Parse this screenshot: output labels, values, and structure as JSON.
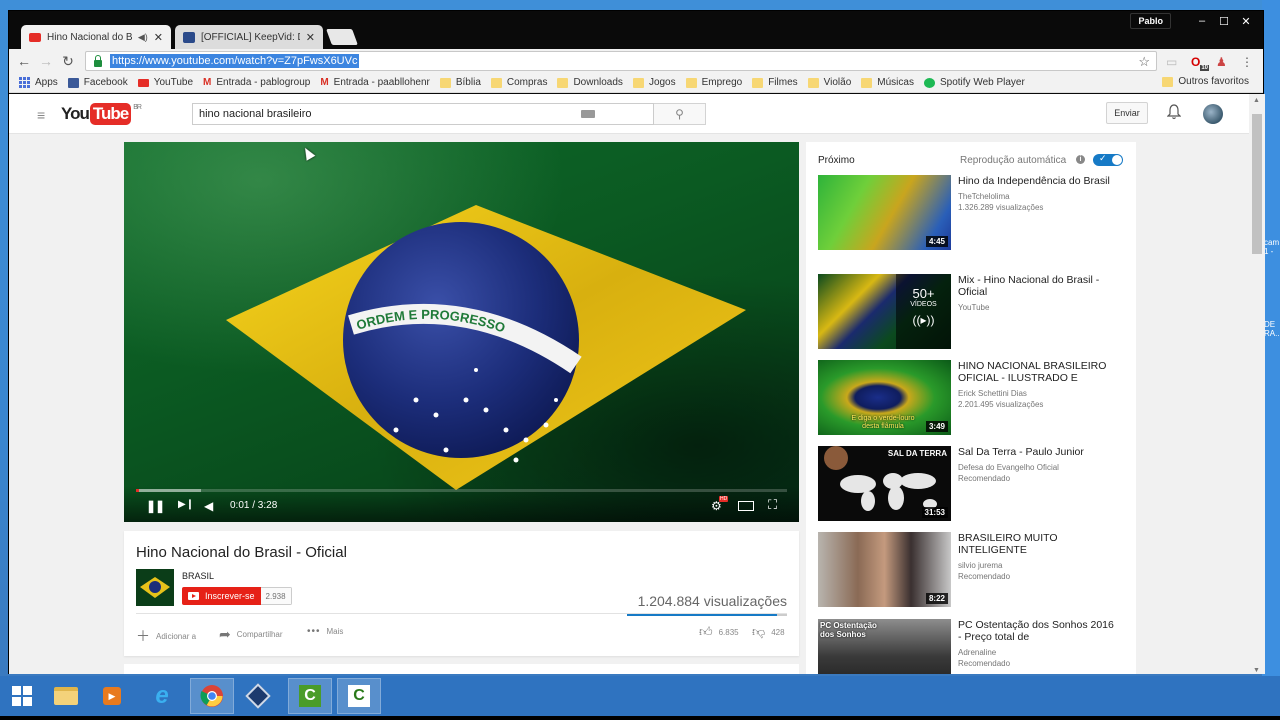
{
  "browser": {
    "tabs": [
      {
        "label": "Hino Nacional do Bra",
        "favicon": "youtube-icon",
        "active": true,
        "audio": true
      },
      {
        "label": "[OFFICIAL] KeepVid: Dow",
        "favicon": "keepvid-icon",
        "active": false
      }
    ],
    "profile_name": "Pablo",
    "window_controls": {
      "minimize": "–",
      "maximize": "☐",
      "close": "✕"
    },
    "url": "https://www.youtube.com/watch?v=Z7pFwsX6UVc",
    "extension_badge": "10",
    "bookmarks": [
      {
        "label": "Apps",
        "icon": "apps-grid-icon"
      },
      {
        "label": "Facebook",
        "icon": "facebook-icon"
      },
      {
        "label": "YouTube",
        "icon": "youtube-icon"
      },
      {
        "label": "Entrada - pablogroup",
        "icon": "gmail-icon"
      },
      {
        "label": "Entrada - paabllohenr",
        "icon": "gmail-icon"
      },
      {
        "label": "Bíblia",
        "icon": "folder-icon"
      },
      {
        "label": "Compras",
        "icon": "folder-icon"
      },
      {
        "label": "Downloads",
        "icon": "folder-icon"
      },
      {
        "label": "Jogos",
        "icon": "folder-icon"
      },
      {
        "label": "Emprego",
        "icon": "folder-icon"
      },
      {
        "label": "Filmes",
        "icon": "folder-icon"
      },
      {
        "label": "Violão",
        "icon": "folder-icon"
      },
      {
        "label": "Músicas",
        "icon": "folder-icon"
      },
      {
        "label": "Spotify Web Player",
        "icon": "spotify-icon"
      }
    ],
    "other_bookmarks": "Outros favoritos"
  },
  "youtube": {
    "logo_you": "You",
    "logo_tube": "Tube",
    "logo_region": "BR",
    "search_value": "hino nacional brasileiro",
    "upload_label": "Enviar",
    "player": {
      "current_time": "0:01",
      "duration": "3:28",
      "time_display": "0:01 / 3:28",
      "played_fraction": 0.005,
      "buffered_fraction": 0.1,
      "hd_badge": "HD",
      "flag_motto": "ORDEM E PROGRESSO"
    },
    "video": {
      "title": "Hino Nacional do Brasil - Oficial",
      "channel": "BRASIL",
      "subscribe_label": "Inscrever-se",
      "subscriber_count": "2.938",
      "views": "1.204.884 visualizações",
      "like_fraction": 0.94,
      "actions": {
        "add": "Adicionar a",
        "share": "Compartilhar",
        "more": "Mais"
      },
      "likes": "6.835",
      "dislikes": "428"
    },
    "sidebar": {
      "up_next_label": "Próximo",
      "autoplay_label": "Reprodução automática",
      "autoplay_on": true,
      "items": [
        {
          "title": "Hino da Independência do Brasil",
          "channel": "TheTchelolima",
          "meta": "1.326.289 visualizações",
          "duration": "4:45"
        },
        {
          "title": "Mix - Hino Nacional do Brasil - Oficial",
          "channel": "YouTube",
          "meta": "",
          "playlist_count": "50+",
          "playlist_label": "VÍDEOS"
        },
        {
          "title": "HINO NACIONAL BRASILEIRO OFICIAL - ILUSTRADO E",
          "channel": "Erick Schettini Dias",
          "meta": "2.201.495 visualizações",
          "duration": "3:49",
          "thumb_caption": "E diga o verde-louro desta flâmula"
        },
        {
          "title": "Sal Da Terra - Paulo Junior",
          "channel": "Defesa do Evangelho Oficial",
          "meta": "Recomendado",
          "duration": "31:53",
          "thumb_caption": "SAL DA TERRA"
        },
        {
          "title": "BRASILEIRO MUITO INTELIGENTE",
          "channel": "silvio jurema",
          "meta": "Recomendado",
          "duration": "8:22"
        },
        {
          "title": "PC Ostentação dos Sonhos 2016 - Preço total de",
          "channel": "Adrenaline",
          "meta": "Recomendado",
          "thumb_caption": "PC Ostentação dos Sonhos"
        }
      ]
    }
  },
  "taskbar": {
    "items": [
      "start-icon",
      "file-explorer-icon",
      "media-player-icon",
      "internet-explorer-icon",
      "chrome-icon",
      "virtualbox-icon",
      "camtasia-icon",
      "camtasia-recorder-icon"
    ]
  },
  "colors": {
    "youtube_red": "#e52d27",
    "subscribe_red": "#e62117",
    "accent_blue": "#167ac6",
    "url_highlight": "#3c85e0"
  }
}
